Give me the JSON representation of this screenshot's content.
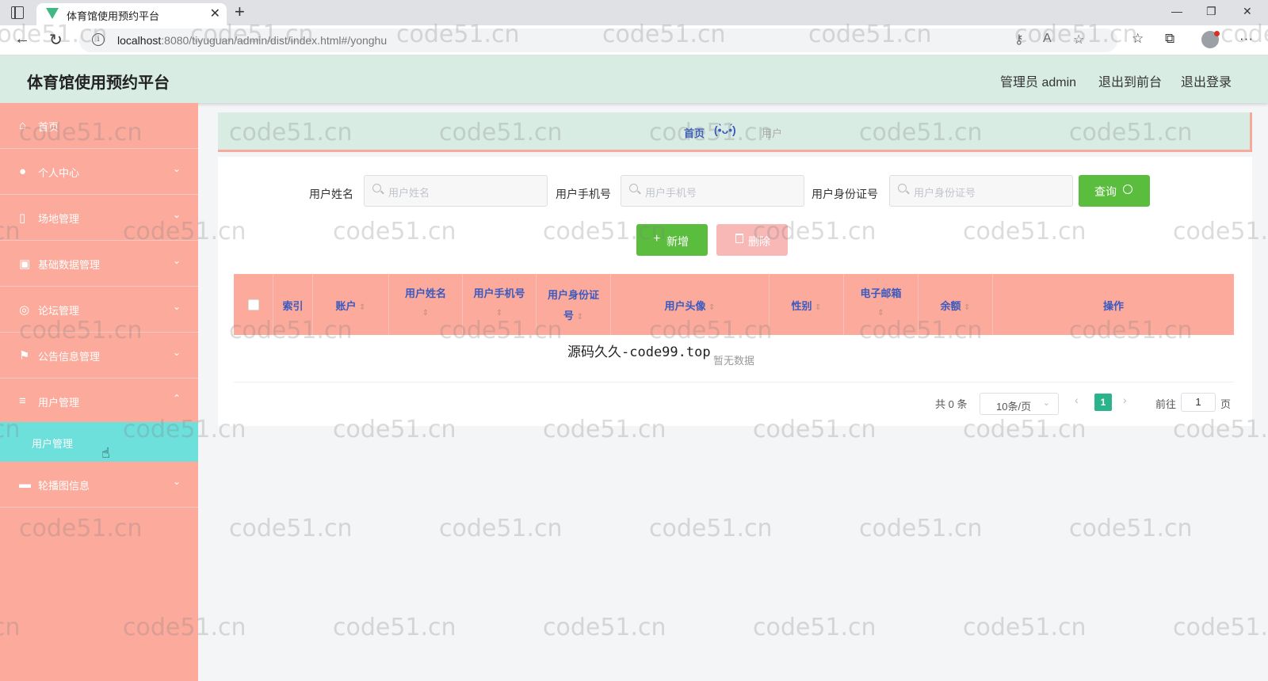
{
  "browser": {
    "tab_title": "体育馆使用预约平台",
    "url_host": "localhost",
    "url_rest": ":8080/tiyuguan/admin/dist/index.html#/yonghu"
  },
  "header": {
    "title": "体育馆使用预约平台",
    "admin_label": "管理员 admin",
    "frontend_link": "退出到前台",
    "logout_link": "退出登录"
  },
  "sidebar": {
    "items": [
      {
        "label": "首页",
        "icon": "home-icon"
      },
      {
        "label": "个人中心",
        "icon": "user-icon"
      },
      {
        "label": "场地管理",
        "icon": "venue-icon"
      },
      {
        "label": "基础数据管理",
        "icon": "data-icon"
      },
      {
        "label": "论坛管理",
        "icon": "forum-icon"
      },
      {
        "label": "公告信息管理",
        "icon": "flag-icon"
      },
      {
        "label": "用户管理",
        "icon": "list-icon"
      },
      {
        "label": "轮播图信息",
        "icon": "carousel-icon"
      }
    ],
    "active_sub": "用户管理"
  },
  "breadcrumb": {
    "home": "首页",
    "separator": "(•̀ᴗ•́)",
    "current": "用户"
  },
  "search": {
    "name_label": "用户姓名",
    "name_placeholder": "用户姓名",
    "phone_label": "用户手机号",
    "phone_placeholder": "用户手机号",
    "id_label": "用户身份证号",
    "id_placeholder": "用户身份证号",
    "query_button": "查询"
  },
  "actions": {
    "add": "新增",
    "delete": "删除"
  },
  "table": {
    "columns": [
      {
        "label": "索引",
        "sortable": false
      },
      {
        "label": "账户",
        "sortable": true
      },
      {
        "label": "用户姓名",
        "sortable": true
      },
      {
        "label": "用户手机号",
        "sortable": true
      },
      {
        "label": "用户身份证号",
        "sortable": true
      },
      {
        "label": "用户头像",
        "sortable": true
      },
      {
        "label": "性别",
        "sortable": true
      },
      {
        "label": "电子邮箱",
        "sortable": true
      },
      {
        "label": "余额",
        "sortable": true
      },
      {
        "label": "操作",
        "sortable": false
      }
    ],
    "empty_text": "暂无数据",
    "overlay_text": "源码久久-code99.top"
  },
  "pagination": {
    "total": "共 0 条",
    "page_size": "10条/页",
    "current_page": "1",
    "goto_label": "前往",
    "goto_value": "1",
    "page_suffix": "页"
  },
  "watermark": "code51.cn",
  "colors": {
    "sidebar": "#fcaa9c",
    "header": "#d8ece4",
    "active": "#6de0dc",
    "primary": "#5bbd3e"
  }
}
